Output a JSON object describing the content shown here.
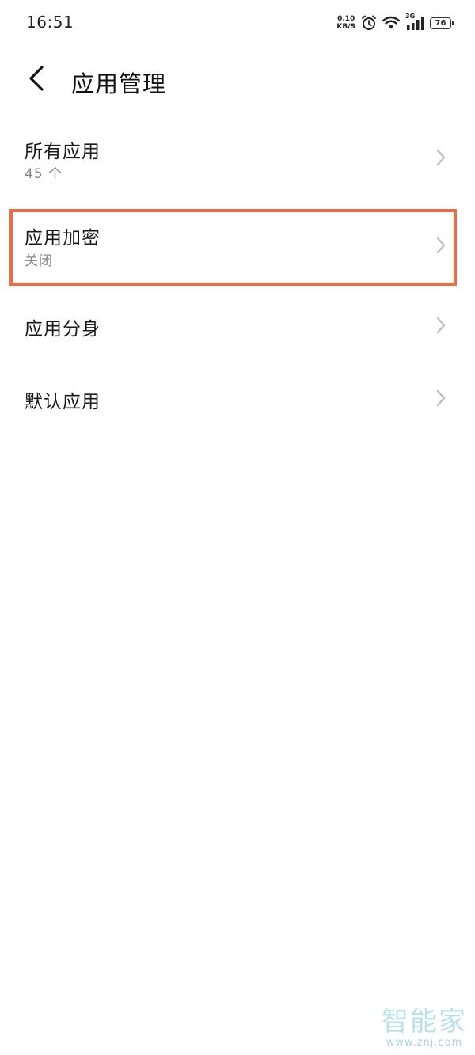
{
  "status_bar": {
    "time": "16:51",
    "net_speed_value": "0.10",
    "net_speed_unit": "KB/S",
    "signal_type": "3G",
    "battery": "76",
    "icons": [
      "alarm-icon",
      "wifi-icon",
      "signal-icon",
      "battery-icon"
    ]
  },
  "header": {
    "title": "应用管理",
    "back_icon": "chevron-left-icon"
  },
  "list": {
    "items": [
      {
        "title": "所有应用",
        "subtitle": "45 个"
      },
      {
        "title": "应用加密",
        "subtitle": "关闭",
        "highlighted": true
      },
      {
        "title": "应用分身"
      },
      {
        "title": "默认应用"
      }
    ]
  },
  "highlight_color": "#ef6c42",
  "watermark": {
    "logo": "智能家",
    "url": "www.znj.com"
  }
}
